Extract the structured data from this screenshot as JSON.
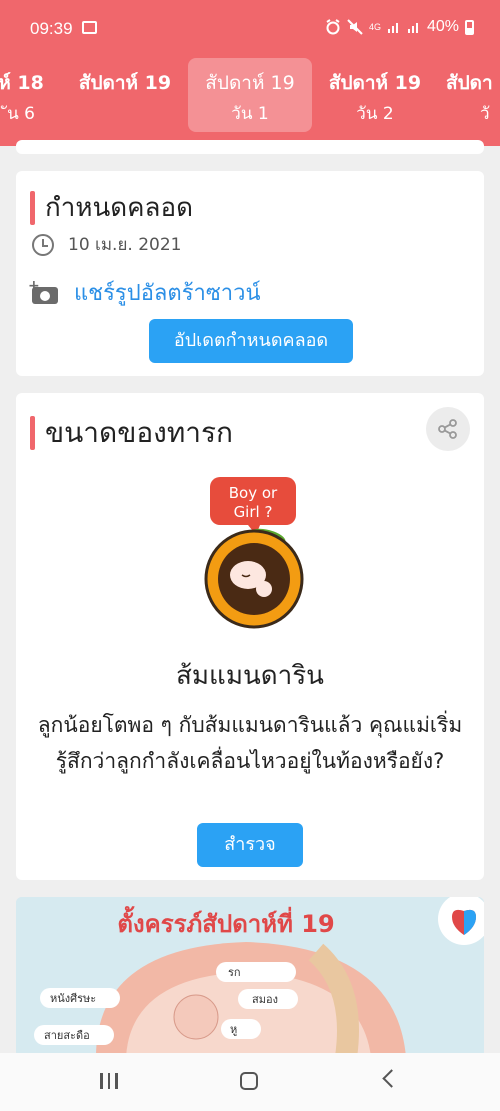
{
  "status": {
    "time": "09:39",
    "network": "4G",
    "battery": "40%"
  },
  "weeks": [
    {
      "week": "ห์ 18",
      "day": "ัน 6"
    },
    {
      "week": "สัปดาห์ 19",
      "day": ""
    },
    {
      "week": "สัปดาห์ 19",
      "day": "วัน 1"
    },
    {
      "week": "สัปดาห์ 19",
      "day": "วัน 2"
    },
    {
      "week": "สัปดา",
      "day": "วั"
    }
  ],
  "due": {
    "title": "กำหนดคลอด",
    "date": "10 เม.ย. 2021",
    "share_link": "แชร์รูปอัลตร้าซาวน์",
    "update_button": "อัปเดตกำหนดคลอด"
  },
  "baby_size": {
    "title": "ขนาดของทารก",
    "bubble_line1": "Boy or",
    "bubble_line2": "Girl ?",
    "fruit": "ส้มแมนดาริน",
    "description": "ลูกน้อยโตพอ ๆ กับส้มแมนดารินแล้ว คุณแม่เริ่มรู้สึกว่าลูกกำลังเคลื่อนไหวอยู่ในท้องหรือยัง?",
    "explore_button": "สำรวจ"
  },
  "infographic": {
    "title": "ตั้งครรภ์สัปดาห์ที่ 19",
    "labels": [
      "รก",
      "หนังศีรษะ",
      "สมอง",
      "หู",
      "สายสะดือ"
    ]
  },
  "colors": {
    "header": "#f0676c",
    "button": "#2ba2f4",
    "link": "#2b8fe6"
  }
}
